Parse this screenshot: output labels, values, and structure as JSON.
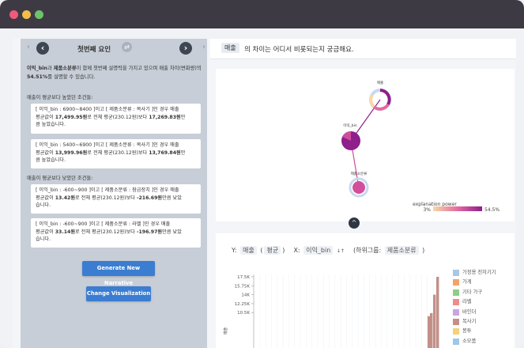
{
  "left_panel": {
    "title": "첫번째 요인",
    "summary_parts": [
      "이익_bin",
      "과 ",
      "제품소분류",
      "이 함께 첫번째 설명력을 가지고 있으며 매출 차이(변화량)의 ",
      "54.51%",
      "를 설명할 수 있습니다."
    ],
    "above_label": "매출이 평균보다 높았던 조건들:",
    "below_label": "매출이 평균보다 낮았던 조건들:",
    "cards": [
      {
        "line1": "[ 이익_bin : 6900~8400 ]이고 [ 제품소분류 : 복사기 ]인 경우 매출",
        "line2_pre": "평균값이 ",
        "value": "17,499.95원",
        "line2_mid": "로 전체 평균(230.12원)보다 ",
        "diff": "17,269.83원",
        "line2_post": "만",
        "line3": "큼 높았습니다."
      },
      {
        "line1": "[ 이익_bin : 5400~6900 ]이고 [ 제품소분류 : 복사기 ]인 경우 매출",
        "line2_pre": "평균값이 ",
        "value": "13,999.96원",
        "line2_mid": "로 전체 평균(230.12원)보다 ",
        "diff": "13,769.84원",
        "line2_post": "만",
        "line3": "큼 높았습니다."
      },
      {
        "line1": "[ 이익_bin : -600~900 ]이고 [ 제품소분류 : 잠금장치 ]인 경우 매출",
        "line2_pre": "평균값이 ",
        "value": "13.42원",
        "line2_mid": "로 전체 평균(230.12원)보다 ",
        "diff": "-216.69원",
        "line2_post": "만큼 낮았",
        "line3": "습니다."
      },
      {
        "line1": "[ 이익_bin : -600~900 ]이고 [ 제품소분류 : 라벨 ]인 경우 매출",
        "line2_pre": "평균값이 ",
        "value": "33.14원",
        "line2_mid": "로 전체 평균(230.12원)보다 ",
        "diff": "-196.97원",
        "line2_post": "만큼 낮았",
        "line3": "습니다."
      }
    ],
    "generate_button": "Generate New Narrative",
    "change_button": "Change Visualization"
  },
  "question": {
    "chip": "매출",
    "text": "의 차이는 어디서 비롯되는지 궁금해요."
  },
  "graph": {
    "nodes": [
      {
        "label": "매출"
      },
      {
        "label": "이익_bin"
      },
      {
        "label": "제품소분류"
      }
    ],
    "legend_title": "explanation power",
    "legend_min": "3%",
    "legend_max": "54.5%",
    "colors": {
      "low": "#f6d9a8",
      "mid": "#e36aa0",
      "high": "#8e1f8b",
      "ring": "#c8d8ef"
    }
  },
  "chart_controls": {
    "y_label": "Y:",
    "y_value": "매출",
    "y_agg": "평균",
    "x_label": "X:",
    "x_value": "이익_bin",
    "sort_icon": "↓↑",
    "group_label": "(하위그룹:",
    "group_value": "제품소분류",
    "group_close": ")"
  },
  "chart_data": {
    "type": "bar",
    "y_ticks": [
      "17.5K",
      "15.75K",
      "14K",
      "12.25K",
      "10.5K"
    ],
    "ylabel": "매출",
    "series": [
      {
        "name": "가정용 전자기기",
        "color": "#a6c8e6"
      },
      {
        "name": "가계",
        "color": "#f2a36b"
      },
      {
        "name": "기타 가구",
        "color": "#8ccf86"
      },
      {
        "name": "라벨",
        "color": "#f28c8c"
      },
      {
        "name": "바인더",
        "color": "#c9a6e0"
      },
      {
        "name": "복사기",
        "color": "#c39088"
      },
      {
        "name": "봉투",
        "color": "#f7d07a"
      },
      {
        "name": "소모품",
        "color": "#9fc7e8"
      }
    ],
    "bars": [
      {
        "series": "복사기",
        "value": 17499.95
      },
      {
        "series": "복사기",
        "value": 13999.96
      },
      {
        "series": "복사기",
        "value": 10400
      },
      {
        "series": "복사기",
        "value": 9800
      }
    ],
    "ylim": [
      9800,
      17800
    ]
  }
}
